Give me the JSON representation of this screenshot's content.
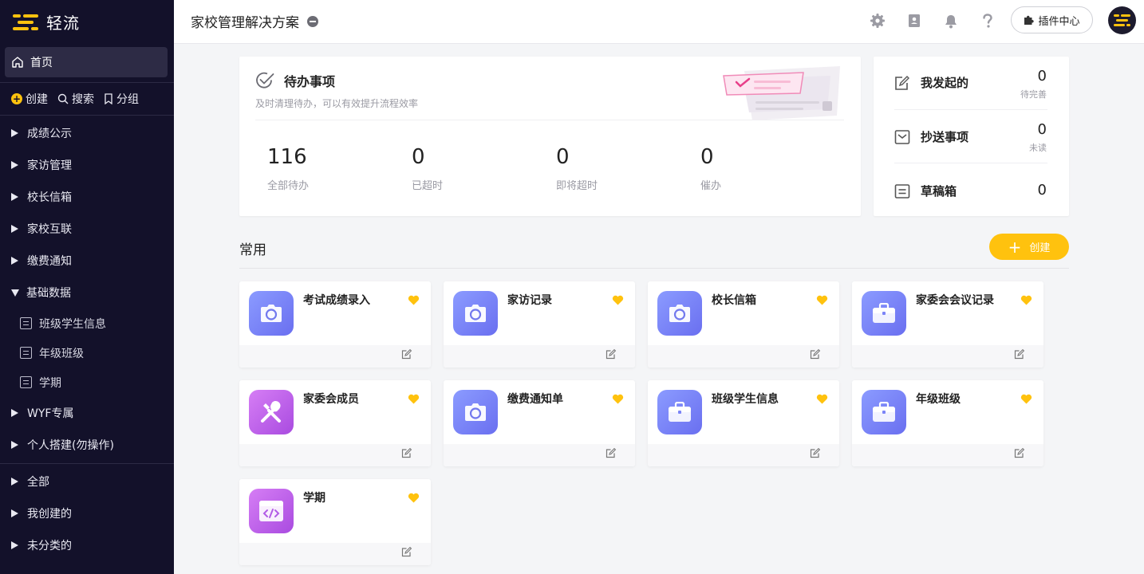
{
  "sidebar": {
    "logo_text": "轻流",
    "home_label": "首页",
    "actions": {
      "create": "创建",
      "search": "搜索",
      "group": "分组"
    },
    "items": [
      {
        "label": "成绩公示"
      },
      {
        "label": "家访管理"
      },
      {
        "label": "校长信箱"
      },
      {
        "label": "家校互联"
      },
      {
        "label": "缴费通知"
      },
      {
        "label": "基础数据"
      },
      {
        "label": "WYF专属"
      },
      {
        "label": "个人搭建(勿操作)"
      }
    ],
    "sub_items": [
      {
        "label": "班级学生信息"
      },
      {
        "label": "年级班级"
      },
      {
        "label": "学期"
      }
    ],
    "bottom_items": [
      {
        "label": "全部"
      },
      {
        "label": "我创建的"
      },
      {
        "label": "未分类的"
      }
    ]
  },
  "header": {
    "title": "家校管理解决方案",
    "plugin_label": "插件中心"
  },
  "todo": {
    "title": "待办事项",
    "subtitle": "及时清理待办，可以有效提升流程效率",
    "stats": [
      {
        "value": "116",
        "label": "全部待办"
      },
      {
        "value": "0",
        "label": "已超时"
      },
      {
        "value": "0",
        "label": "即将超时"
      },
      {
        "value": "0",
        "label": "催办"
      }
    ]
  },
  "side_panel": {
    "initiated": {
      "label": "我发起的",
      "value": "0",
      "sub": "待完善"
    },
    "cc": {
      "label": "抄送事项",
      "value": "0",
      "sub": "未读"
    },
    "drafts": {
      "label": "草稿箱",
      "value": "0"
    }
  },
  "common": {
    "title": "常用",
    "create_label": "创建",
    "apps": [
      {
        "name": "考试成绩录入",
        "icon": "camera-icon"
      },
      {
        "name": "家访记录",
        "icon": "camera-icon"
      },
      {
        "name": "校长信箱",
        "icon": "camera-icon"
      },
      {
        "name": "家委会会议记录",
        "icon": "briefcase-icon"
      },
      {
        "name": "家委会成员",
        "icon": "tools-icon"
      },
      {
        "name": "缴费通知单",
        "icon": "camera-icon"
      },
      {
        "name": "班级学生信息",
        "icon": "briefcase-icon"
      },
      {
        "name": "年级班级",
        "icon": "briefcase-icon"
      },
      {
        "name": "学期",
        "icon": "code-window-icon"
      }
    ]
  },
  "colors": {
    "accent": "#ffc20e",
    "sidebar_bg": "#13112a",
    "icon_blue": "#7b84f7",
    "icon_purple": "#c064ec"
  }
}
